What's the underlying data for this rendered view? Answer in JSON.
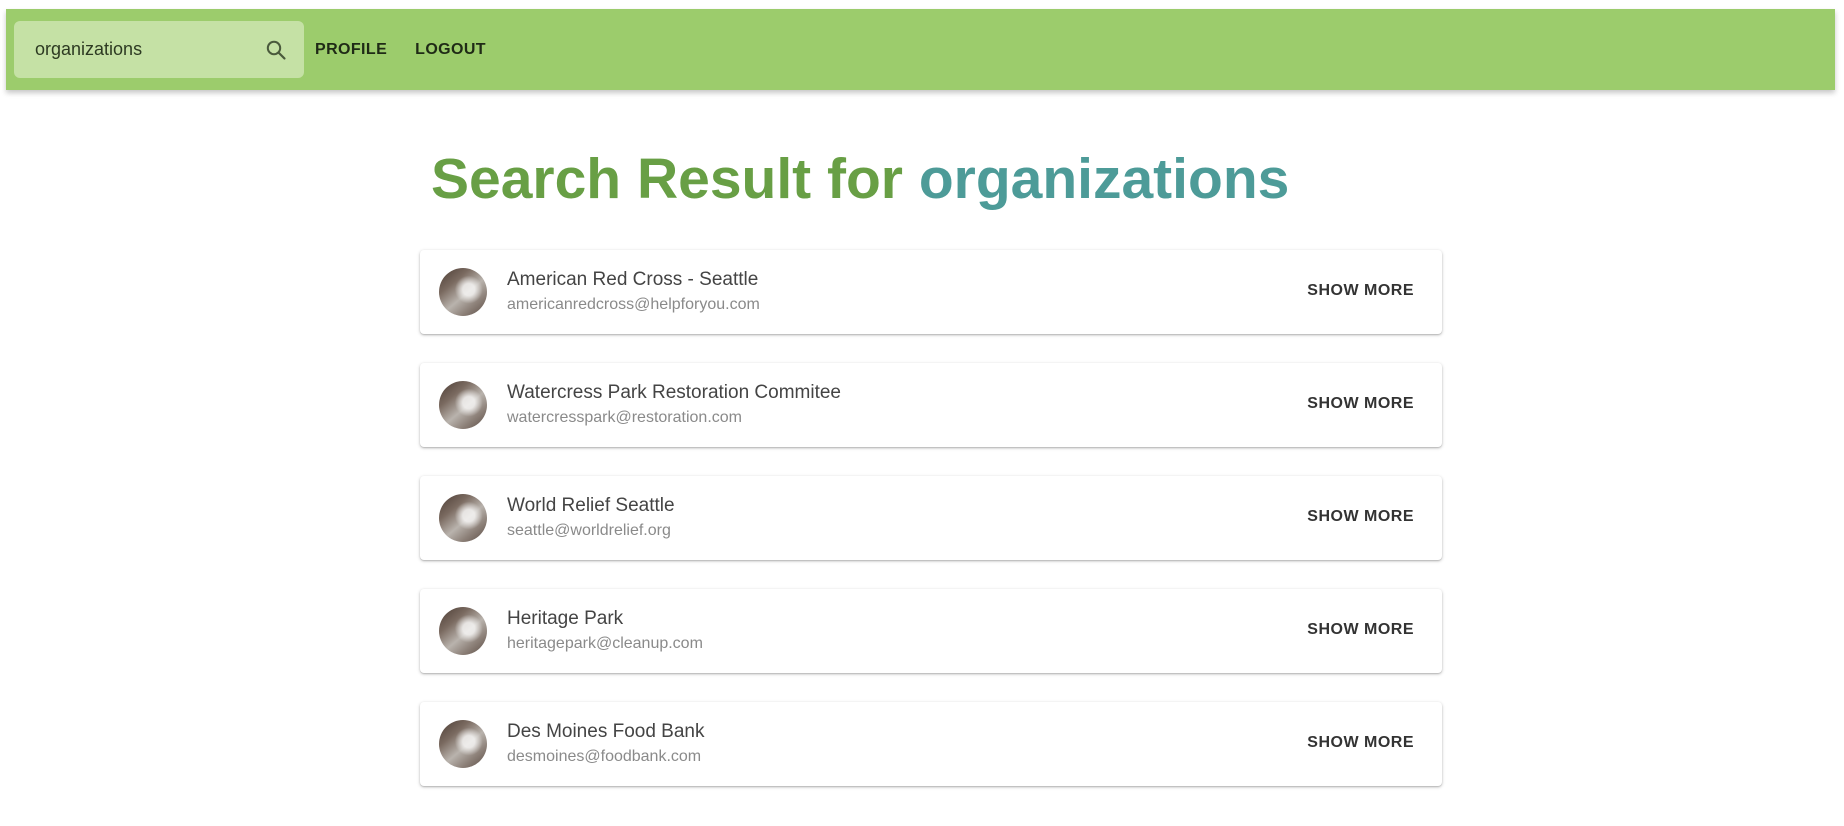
{
  "header": {
    "search": {
      "value": "organizations",
      "placeholder": ""
    },
    "nav": {
      "profile_label": "PROFILE",
      "logout_label": "LOGOUT"
    }
  },
  "main": {
    "title_prefix": "Search Result for ",
    "title_query": "organizations",
    "show_more_label": "SHOW MORE",
    "results": [
      {
        "name": "American Red Cross - Seattle",
        "email": "americanredcross@helpforyou.com"
      },
      {
        "name": "Watercress Park Restoration Commitee",
        "email": "watercresspark@restoration.com"
      },
      {
        "name": "World Relief Seattle",
        "email": "seattle@worldrelief.org"
      },
      {
        "name": "Heritage Park",
        "email": "heritagepark@cleanup.com"
      },
      {
        "name": "Des Moines Food Bank",
        "email": "desmoines@foodbank.com"
      }
    ]
  },
  "colors": {
    "appbar": "#9ccc6c",
    "search_box": "#c5e1a5",
    "title_prefix": "#689f45",
    "title_query": "#4d9b98"
  },
  "icons": {
    "search": "search-icon",
    "avatar": "avatar"
  }
}
